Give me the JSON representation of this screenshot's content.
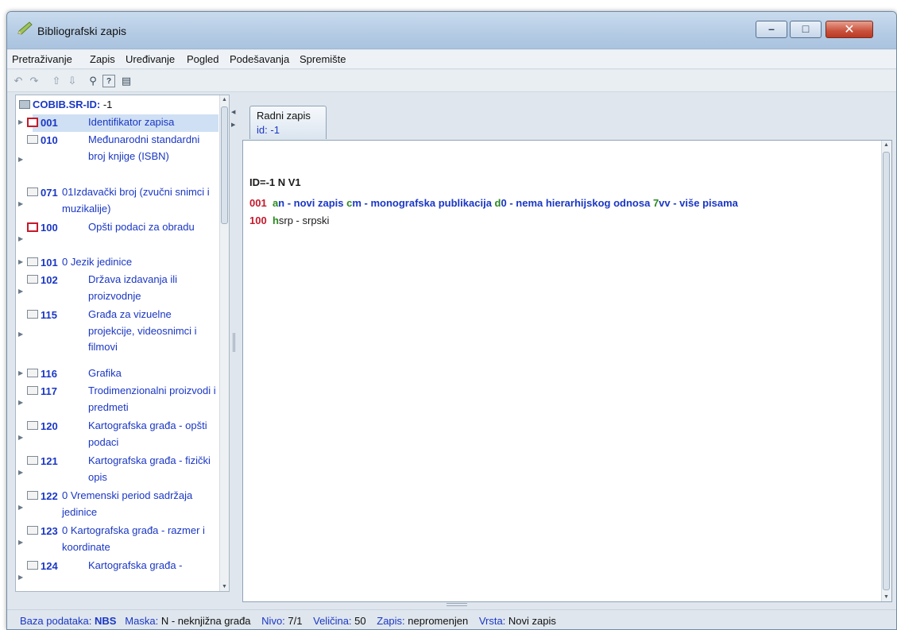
{
  "window": {
    "title": "Bibliografski zapis",
    "controls": {
      "minimize": "–",
      "maximize": "□",
      "close": "✕"
    }
  },
  "menu": [
    "Pretraživanje",
    "Zapis",
    "Uređivanje",
    "Pogled",
    "Podešavanja",
    "Spremište"
  ],
  "toolbar": {
    "icons": [
      "undo-icon",
      "redo-icon",
      "move-up-icon",
      "move-down-icon",
      "search-icon",
      "help-icon",
      "keyboard-icon"
    ],
    "glyphs": [
      "↶",
      "↷",
      "⇧",
      "⇩",
      "⚲",
      "?",
      "▤"
    ]
  },
  "tree": {
    "root_label": "COBIB.SR-ID:",
    "root_value": "-1",
    "nodes": [
      {
        "code": "001",
        "name": "Identifikator zapisa"
      },
      {
        "code": "010",
        "name": "Međunarodni standardni broj knjige (ISBN)"
      },
      {
        "code": "071",
        "name": "01Izdavački broj (zvučni snimci i muzikalije)"
      },
      {
        "code": "100",
        "name": "Opšti podaci za obradu"
      },
      {
        "code": "101",
        "name": "0 Jezik jedinice"
      },
      {
        "code": "102",
        "name": "Država izdavanja ili proizvodnje"
      },
      {
        "code": "115",
        "name": "Građa za vizuelne projekcije, videosnimci i filmovi"
      },
      {
        "code": "116",
        "name": "Grafika"
      },
      {
        "code": "117",
        "name": "Trodimenzionalni proizvodi i predmeti"
      },
      {
        "code": "120",
        "name": "Kartografska građa - opšti podaci"
      },
      {
        "code": "121",
        "name": "Kartografska građa - fizički opis"
      },
      {
        "code": "122",
        "name": "0 Vremenski period sadržaja jedinice"
      },
      {
        "code": "123",
        "name": "0 Kartografska građa - razmer i koordinate"
      },
      {
        "code": "124",
        "name": "Kartografska građa -"
      }
    ]
  },
  "tab": {
    "name": "Radni zapis",
    "id_label": "id:",
    "id_value": "-1"
  },
  "record": {
    "header": "ID=-1 N V1",
    "line1": {
      "tag": "001",
      "s1": "a",
      "t1": "n - novi zapis ",
      "s2": "c",
      "t2": "m - monografska publikacija ",
      "s3": "d",
      "t3": "0 - nema hierarhijskog odnosa ",
      "s4": "7",
      "t4": "vv - više pisama"
    },
    "line2": {
      "tag": "100",
      "s1": "h",
      "t1": "srp - srpski"
    }
  },
  "status": {
    "db_label": "Baza podataka:",
    "db_value": "NBS",
    "mask_label": "Maska:",
    "mask_value": "N - neknjižna građa",
    "level_label": "Nivo:",
    "level_value": "7/1",
    "size_label": "Veličina:",
    "size_value": "50",
    "record_label": "Zapis:",
    "record_value": "nepromenjen",
    "type_label": "Vrsta:",
    "type_value": "Novi zapis"
  },
  "colors": {
    "tag": "#c51a2b",
    "subfield": "#2a8a1f",
    "text": "#1a37c4",
    "selection": "#cfe0f4"
  }
}
